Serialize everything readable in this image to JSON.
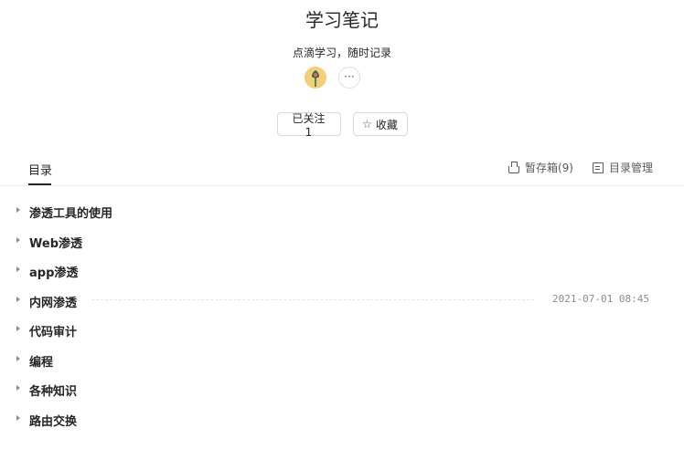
{
  "book": {
    "title": "学习笔记",
    "description": "点滴学习，随时记录",
    "more_label": "···"
  },
  "actions": {
    "follow_label": "已关注 1",
    "collect_label": "收藏",
    "collect_icon": "star-outline-icon"
  },
  "tabs": {
    "toc_label": "目录",
    "drafts_label": "暂存箱(9)",
    "drafts_icon": "tray-icon",
    "manage_label": "目录管理",
    "manage_icon": "list-box-icon"
  },
  "toc": {
    "items": [
      {
        "label": "渗透工具的使用",
        "date": ""
      },
      {
        "label": "Web渗透",
        "date": ""
      },
      {
        "label": "app渗透",
        "date": ""
      },
      {
        "label": "内网渗透",
        "date": "2021-07-01 08:45"
      },
      {
        "label": "代码审计",
        "date": ""
      },
      {
        "label": "编程",
        "date": ""
      },
      {
        "label": "各种知识",
        "date": ""
      },
      {
        "label": "路由交换",
        "date": ""
      }
    ]
  },
  "colors": {
    "text": "#262626",
    "muted": "#8c8c8c",
    "avatar_bg": "#f2d27a"
  }
}
